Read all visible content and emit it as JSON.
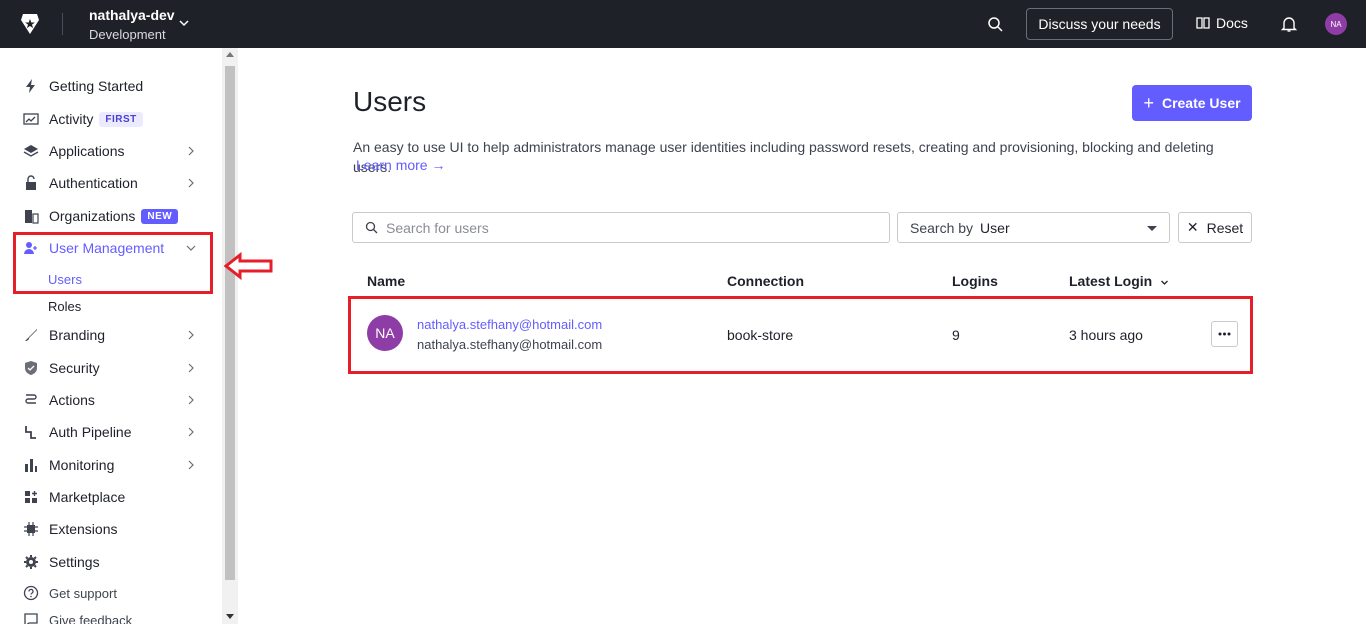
{
  "topbar": {
    "tenant_name": "nathalya-dev",
    "tenant_env": "Development",
    "discuss_label": "Discuss your needs",
    "docs_label": "Docs",
    "avatar_initials": "NA"
  },
  "sidebar": {
    "getting_started": "Getting Started",
    "activity": "Activity",
    "activity_badge": "FIRST",
    "applications": "Applications",
    "authentication": "Authentication",
    "organizations": "Organizations",
    "organizations_badge": "NEW",
    "user_management": "User Management",
    "users": "Users",
    "roles": "Roles",
    "branding": "Branding",
    "security": "Security",
    "actions": "Actions",
    "auth_pipeline": "Auth Pipeline",
    "monitoring": "Monitoring",
    "marketplace": "Marketplace",
    "extensions": "Extensions",
    "settings": "Settings",
    "get_support": "Get support",
    "give_feedback": "Give feedback"
  },
  "main": {
    "title": "Users",
    "create_button": "Create User",
    "description": "An easy to use UI to help administrators manage user identities including password resets, creating and provisioning, blocking and deleting users.",
    "learn_more": "Learn more →",
    "search_placeholder": "Search for users",
    "search_by_label": "Search by",
    "search_by_value": "User",
    "reset_label": "Reset"
  },
  "table": {
    "headers": {
      "name": "Name",
      "connection": "Connection",
      "logins": "Logins",
      "latest_login": "Latest Login"
    },
    "rows": [
      {
        "initials": "NA",
        "email": "nathalya.stefhany@hotmail.com",
        "secondary": "nathalya.stefhany@hotmail.com",
        "connection": "book-store",
        "logins": "9",
        "latest_login": "3 hours ago"
      }
    ]
  },
  "colors": {
    "accent": "#635dff",
    "topbar_bg": "#1f2128",
    "avatar": "#8e3ca6",
    "highlight": "#e51e2a"
  }
}
